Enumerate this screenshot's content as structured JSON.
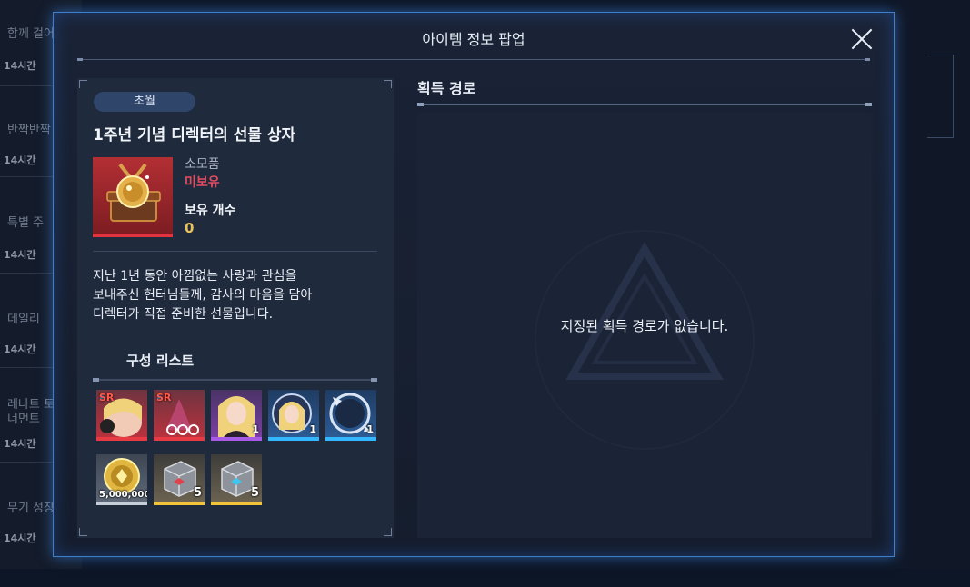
{
  "background": {
    "list_items": [
      {
        "title": "함께 걸어",
        "time": "14시간"
      },
      {
        "title": "반짝반짝 선",
        "time": "14시간"
      },
      {
        "title": "특별 주",
        "time": "14시간"
      },
      {
        "title": "데일리 ",
        "time": "14시간"
      },
      {
        "title": "레나트 토너먼트",
        "time": "14시간"
      },
      {
        "title": "무기 성장",
        "time": "14시간"
      }
    ]
  },
  "popup": {
    "title": "아이템 정보 팝업",
    "close_icon": "close-icon"
  },
  "item": {
    "grade": "초월",
    "name": "1주년 기념 디렉터의 선물 상자",
    "icon": "medal-box-icon",
    "type": "소모품",
    "ownership": "미보유",
    "count_label": "보유 개수",
    "count_value": "0",
    "description": [
      "지난 1년 동안 아낌없는 사랑과 관심을",
      "보내주신 헌터님들께, 감사의 마음을 담아",
      "디렉터가 직접 준비한 선물입니다."
    ]
  },
  "composition": {
    "title": "구성 리스트",
    "items": [
      {
        "icon": "sr-character-card-icon",
        "grade": "SR",
        "quantity": "",
        "frame": "red"
      },
      {
        "icon": "sr-character-card-icon",
        "grade": "SR",
        "quantity": "",
        "frame": "red"
      },
      {
        "icon": "character-portrait-icon",
        "grade": "",
        "quantity": "1",
        "frame": "purple"
      },
      {
        "icon": "character-token-icon",
        "grade": "",
        "quantity": "1",
        "frame": "blue"
      },
      {
        "icon": "portrait-frame-icon",
        "grade": "",
        "quantity": "1",
        "frame": "blue"
      },
      {
        "icon": "gold-coin-icon",
        "grade": "",
        "quantity": "5,000,000",
        "frame": "white"
      },
      {
        "icon": "red-supply-box-icon",
        "grade": "",
        "quantity": "5",
        "frame": "gold"
      },
      {
        "icon": "blue-supply-box-icon",
        "grade": "",
        "quantity": "5",
        "frame": "gold"
      }
    ]
  },
  "acquisition": {
    "title": "획득 경로",
    "empty_message": "지정된 획득 경로가 없습니다."
  },
  "colors": {
    "popup_border": "#3f7ec9",
    "ownership_red": "#e24d62",
    "count_gold": "#e8c25a"
  }
}
